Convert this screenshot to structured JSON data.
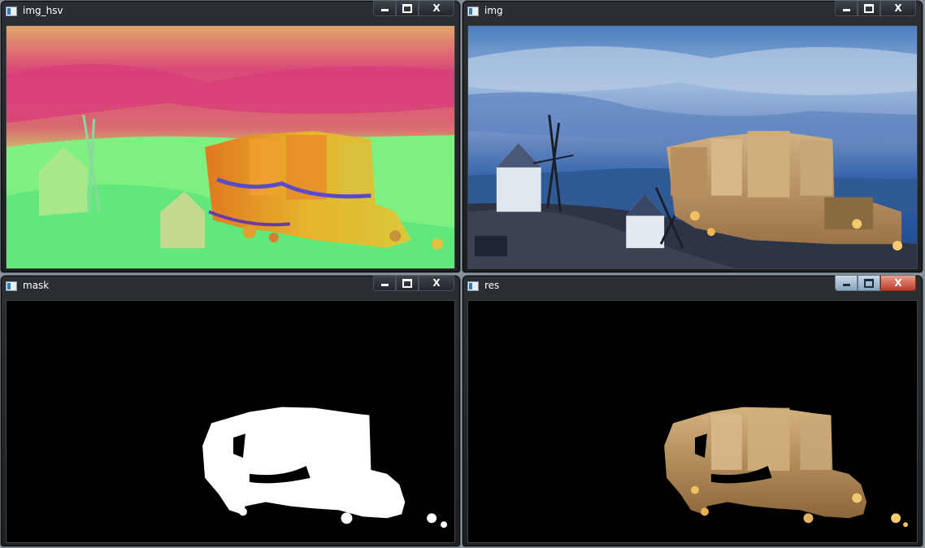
{
  "windows": {
    "hsv": {
      "title": "img_hsv"
    },
    "img": {
      "title": "img"
    },
    "mask": {
      "title": "mask"
    },
    "res": {
      "title": "res"
    }
  },
  "caption_buttons": {
    "minimize": "minimize-icon",
    "maximize": "maximize-icon",
    "close": "close-icon",
    "close_glyph": "X"
  },
  "colors": {
    "hsv_pink": "#d94a78",
    "hsv_green": "#6ff27a",
    "hsv_yellow": "#e6b52c",
    "sky_blue": "#5a86c0",
    "castle_gold": "#c8a06a",
    "mask_white": "#ffffff",
    "background": "#000000",
    "close_red": "#c0392b"
  }
}
